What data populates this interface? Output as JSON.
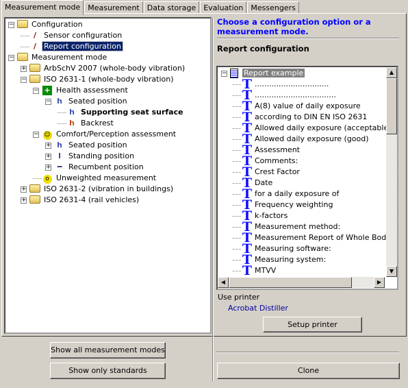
{
  "tabs": [
    "Measurement mode",
    "Measurement",
    "Data storage",
    "Evaluation",
    "Messengers"
  ],
  "tree": [
    {
      "label": "Configuration",
      "level": 0,
      "icon": "folder-icon",
      "exp": "-"
    },
    {
      "label": "Sensor configuration",
      "level": 1,
      "icon": "pencil-icon",
      "exp": ""
    },
    {
      "label": "Report configuration",
      "level": 1,
      "icon": "pencil-icon",
      "exp": "",
      "selected": true
    },
    {
      "label": "Measurement mode",
      "level": 0,
      "icon": "folder-icon",
      "exp": "-"
    },
    {
      "label": "ArbSchV 2007 (whole-body vibration)",
      "level": 1,
      "icon": "folder-icon",
      "exp": "+"
    },
    {
      "label": "ISO 2631-1 (whole-body vibration)",
      "level": 1,
      "icon": "folder-icon",
      "exp": "-"
    },
    {
      "label": "Health assessment",
      "level": 2,
      "icon": "health-cross-icon",
      "exp": "-"
    },
    {
      "label": "Seated position",
      "level": 3,
      "icon": "seated-person-icon",
      "exp": "-"
    },
    {
      "label": "Supporting seat surface",
      "level": 4,
      "icon": "seated-person-icon",
      "exp": "",
      "bold": true
    },
    {
      "label": "Backrest",
      "level": 4,
      "icon": "backrest-person-icon",
      "exp": ""
    },
    {
      "label": "Comfort/Perception assessment",
      "level": 2,
      "icon": "smiley-icon",
      "exp": "-"
    },
    {
      "label": "Seated position",
      "level": 3,
      "icon": "seated-person-icon",
      "exp": "+"
    },
    {
      "label": "Standing position",
      "level": 3,
      "icon": "standing-person-icon",
      "exp": "+"
    },
    {
      "label": "Recumbent position",
      "level": 3,
      "icon": "recumbent-person-icon",
      "exp": "+"
    },
    {
      "label": "Unweighted measurement",
      "level": 2,
      "icon": "surprised-face-icon",
      "exp": ""
    },
    {
      "label": "ISO 2631-2 (vibration in buildings)",
      "level": 1,
      "icon": "folder-icon",
      "exp": "+"
    },
    {
      "label": "ISO 2631-4 (rail vehicles)",
      "level": 1,
      "icon": "folder-icon",
      "exp": "+"
    }
  ],
  "left_buttons": {
    "show_all": "Show all measurement modes",
    "show_standards": "Show only standards"
  },
  "right": {
    "hint": "Choose a configuration option or a measurement mode.",
    "section_title": "Report configuration",
    "report_root": "Report example",
    "report_items": [
      "...............................",
      "..................................",
      "A(8) value of daily exposure",
      "according to DIN EN ISO 2631",
      "Allowed daily exposure (acceptable)",
      "Allowed daily exposure (good)",
      "Assessment",
      "Comments:",
      "Crest Factor",
      "Date",
      "for a daily exposure of",
      "Frequency weighting",
      "k-factors",
      "Measurement method:",
      "Measurement Report of Whole Body Vi",
      "Measuring software:",
      "Measuring system:",
      "MTVV"
    ],
    "use_printer_label": "Use printer",
    "printer_name": "Acrobat Distiller",
    "setup_printer": "Setup printer",
    "clone": "Clone"
  },
  "colors": {
    "hint": "#0000ff",
    "selection": "#0a246a",
    "printer": "#0000a0",
    "text_icon": "#1010ff"
  }
}
